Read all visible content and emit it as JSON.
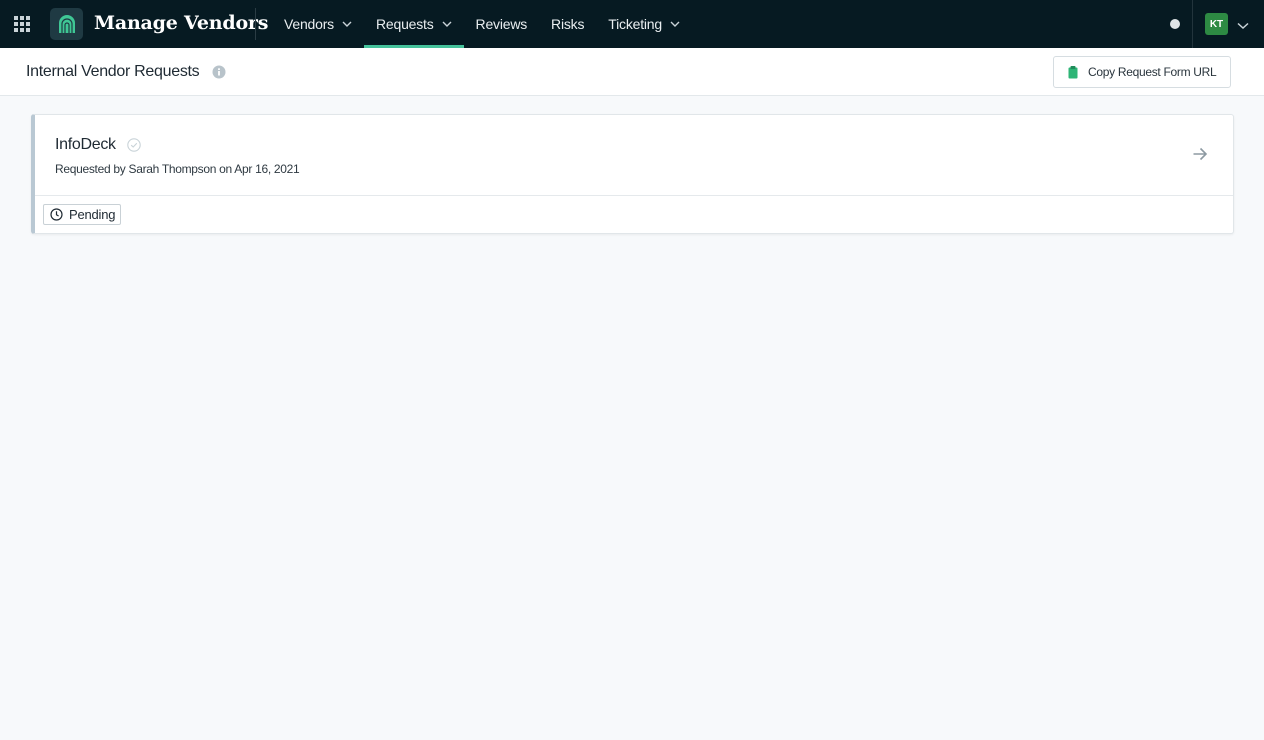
{
  "app": {
    "title": "Manage Vendors",
    "accent_color": "#45c29b",
    "topbar_color": "#061a22"
  },
  "nav": {
    "items": [
      {
        "label": "Vendors",
        "has_dropdown": true,
        "active": false
      },
      {
        "label": "Requests",
        "has_dropdown": true,
        "active": true
      },
      {
        "label": "Reviews",
        "has_dropdown": false,
        "active": false
      },
      {
        "label": "Risks",
        "has_dropdown": false,
        "active": false
      },
      {
        "label": "Ticketing",
        "has_dropdown": true,
        "active": false
      }
    ]
  },
  "user": {
    "initials": "KT",
    "avatar_color": "#2d8a43"
  },
  "page": {
    "title": "Internal Vendor Requests",
    "copy_button_label": "Copy Request Form URL"
  },
  "requests": [
    {
      "vendor": "InfoDeck",
      "requested_by": "Requested by Sarah Thompson on Apr 16, 2021",
      "status": "Pending"
    }
  ]
}
